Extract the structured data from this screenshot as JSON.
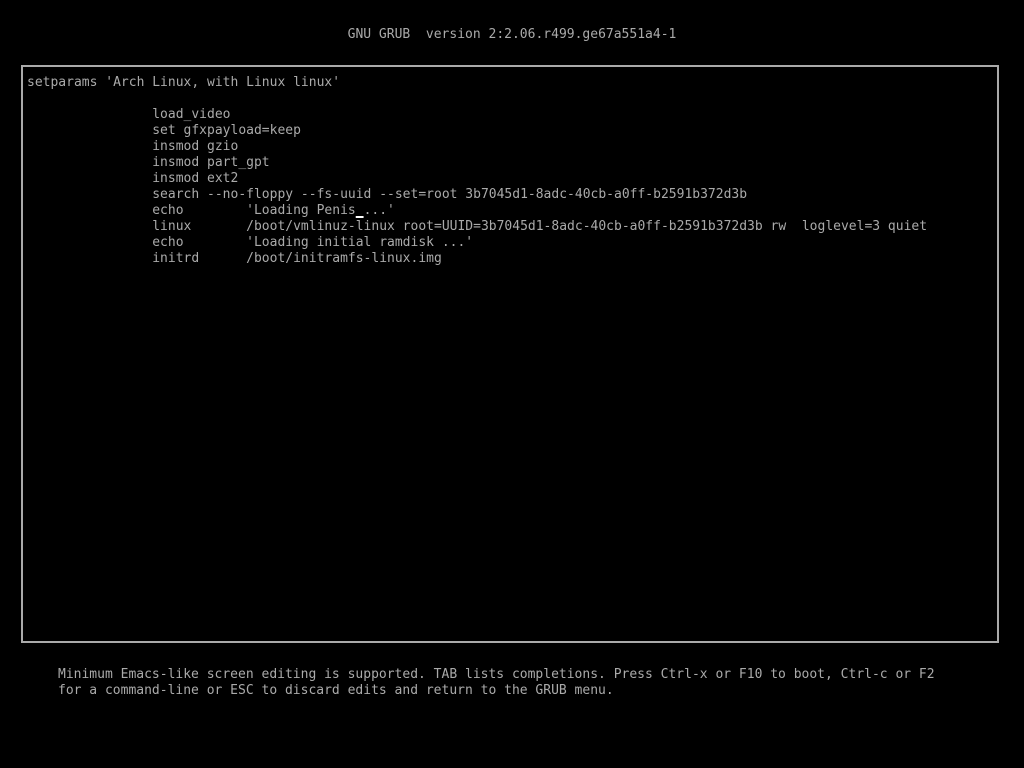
{
  "header": {
    "title": "GNU GRUB  version 2:2.06.r499.ge67a551a4-1"
  },
  "editor": {
    "lines": [
      "setparams 'Arch Linux, with Linux linux'",
      "",
      "                load_video",
      "                set gfxpayload=keep",
      "                insmod gzio",
      "                insmod part_gpt",
      "                insmod ext2",
      "                search --no-floppy --fs-uuid --set=root 3b7045d1-8adc-40cb-a0ff-b2591b372d3b",
      "                echo        'Loading Penis",
      "                linux       /boot/vmlinuz-linux root=UUID=3b7045d1-8adc-40cb-a0ff-b2591b372d3b rw  loglevel=3 quiet",
      "                echo        'Loading initial ramdisk ...'",
      "                initrd      /boot/initramfs-linux.img"
    ],
    "cursor_line": {
      "before": "                echo        'Loading Penis",
      "cursor_char": " ",
      "after": "...'"
    }
  },
  "help": {
    "line1": "Minimum Emacs-like screen editing is supported. TAB lists completions. Press Ctrl-x or F10 to boot, Ctrl-c or F2",
    "line2": "for a command-line or ESC to discard edits and return to the GRUB menu."
  },
  "colors": {
    "background": "#000000",
    "text": "#aaaaaa",
    "border": "#aaaaaa"
  }
}
